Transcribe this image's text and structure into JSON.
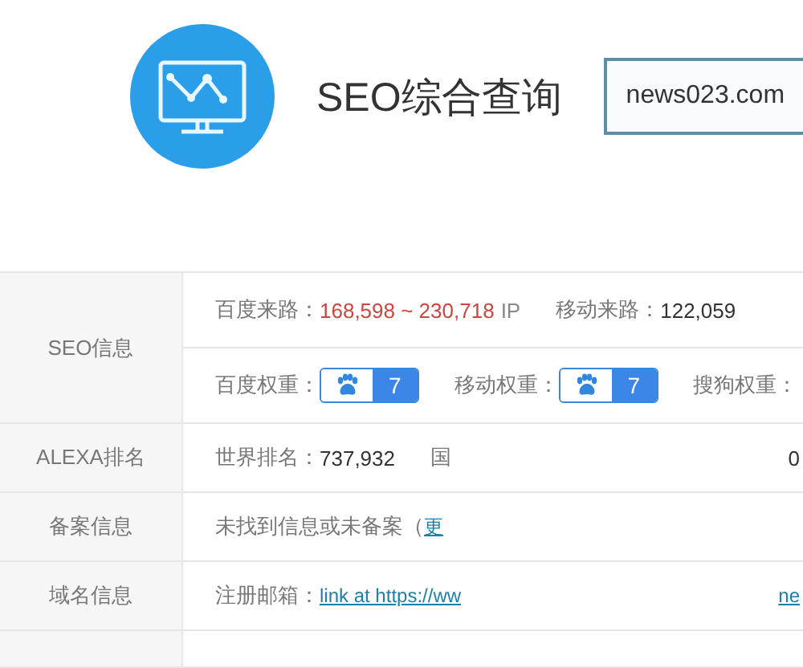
{
  "header": {
    "title": "SEO综合查询",
    "search": {
      "value": "news023.com"
    }
  },
  "table": {
    "rows": [
      {
        "label": "SEO信息",
        "lines": [
          [
            {
              "kind": "label",
              "text": "百度来路："
            },
            {
              "kind": "highlight",
              "text": "168,598 ~ 230,718"
            },
            {
              "kind": "plain",
              "text": "IP"
            },
            {
              "kind": "label",
              "text": "移动来路："
            },
            {
              "kind": "value",
              "text": "122,059"
            }
          ],
          [
            {
              "kind": "label",
              "text": "百度权重："
            },
            {
              "kind": "badge",
              "text": "7"
            },
            {
              "kind": "label",
              "text": "移动权重："
            },
            {
              "kind": "badge",
              "text": "7"
            },
            {
              "kind": "label",
              "text": "搜狗权重："
            }
          ]
        ]
      },
      {
        "label": "ALEXA排名",
        "lines": [
          [
            {
              "kind": "label",
              "text": "世界排名："
            },
            {
              "kind": "value",
              "text": "737,932"
            },
            {
              "kind": "label",
              "text": "国"
            },
            {
              "kind": "edge",
              "text": "0"
            }
          ]
        ]
      },
      {
        "label": "备案信息",
        "lines": [
          [
            {
              "kind": "label",
              "text": "未找到信息或未备案（"
            },
            {
              "kind": "link",
              "text": "更"
            }
          ]
        ]
      },
      {
        "label": "域名信息",
        "lines": [
          [
            {
              "kind": "label",
              "text": "注册邮箱："
            },
            {
              "kind": "link",
              "text": "link at https://ww"
            },
            {
              "kind": "edgelink",
              "text": "ne"
            }
          ]
        ]
      }
    ]
  }
}
